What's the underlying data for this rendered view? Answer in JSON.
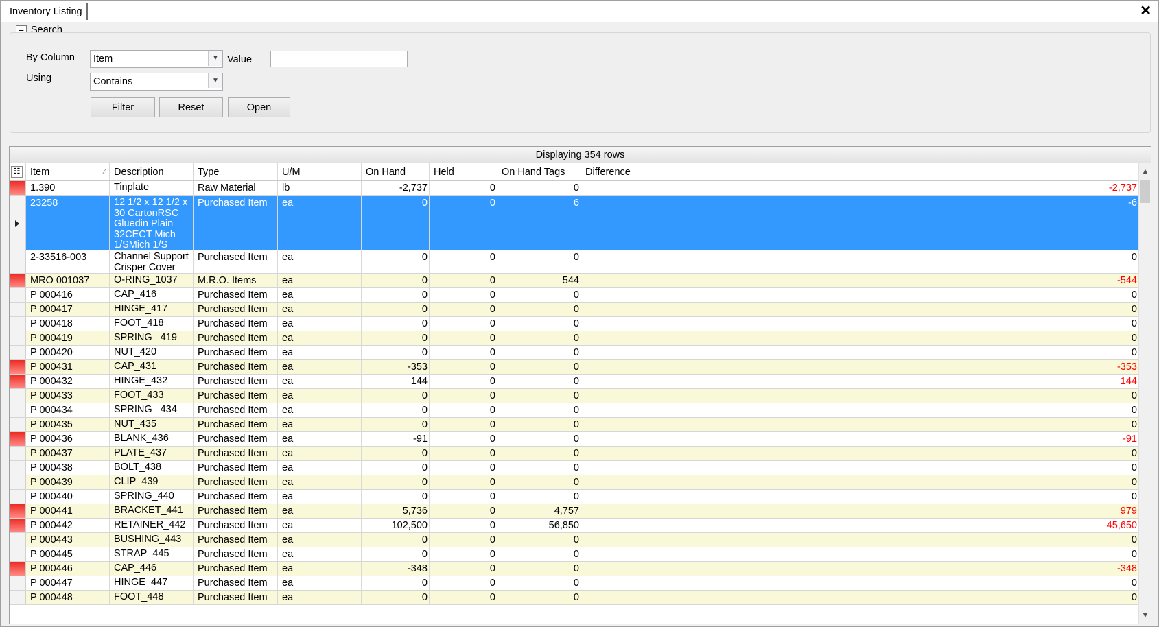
{
  "tab": {
    "title": "Inventory Listing",
    "close": "✕"
  },
  "search": {
    "collapse_glyph": "−",
    "title": "Search",
    "by_column_label": "By Column",
    "by_column_value": "Item",
    "value_label": "Value",
    "value_text": "",
    "using_label": "Using",
    "using_value": "Contains",
    "filter_label": "Filter",
    "reset_label": "Reset",
    "open_label": "Open"
  },
  "grid": {
    "banner": "Displaying 354 rows",
    "columns": [
      "Item",
      "Description",
      "Type",
      "U/M",
      "On Hand",
      "Held",
      "On Hand Tags",
      "Difference"
    ],
    "rows": [
      {
        "item": "1.390",
        "description": "Tinplate",
        "type": "Raw Material",
        "um": "lb",
        "on_hand": "-2,737",
        "held": "0",
        "tags": "0",
        "difference": "-2,737",
        "flag": true,
        "neg": true
      },
      {
        "item": "23258",
        "description": "12 1/2 x 12 1/2 x 30 CartonRSC Gluedin Plain 32CECT Mich 1/SMich 1/S",
        "type": "Purchased Item",
        "um": "ea",
        "on_hand": "0",
        "held": "0",
        "tags": "6",
        "difference": "-6",
        "flag": false,
        "neg": true,
        "selected": true
      },
      {
        "item": "2-33516-003",
        "description": "Channel Support Crisper Cover",
        "type": "Purchased Item",
        "um": "ea",
        "on_hand": "0",
        "held": "0",
        "tags": "0",
        "difference": "0",
        "flag": false,
        "neg": false
      },
      {
        "item": "MRO 001037",
        "description": "O-RING_1037",
        "type": "M.R.O. Items",
        "um": "ea",
        "on_hand": "0",
        "held": "0",
        "tags": "544",
        "difference": "-544",
        "flag": true,
        "neg": true
      },
      {
        "item": "P 000416",
        "description": "CAP_416",
        "type": "Purchased Item",
        "um": "ea",
        "on_hand": "0",
        "held": "0",
        "tags": "0",
        "difference": "0",
        "flag": false,
        "neg": false
      },
      {
        "item": "P 000417",
        "description": "HINGE_417",
        "type": "Purchased Item",
        "um": "ea",
        "on_hand": "0",
        "held": "0",
        "tags": "0",
        "difference": "0",
        "flag": false,
        "neg": false
      },
      {
        "item": "P 000418",
        "description": "FOOT_418",
        "type": "Purchased Item",
        "um": "ea",
        "on_hand": "0",
        "held": "0",
        "tags": "0",
        "difference": "0",
        "flag": false,
        "neg": false
      },
      {
        "item": "P 000419",
        "description": "SPRING _419",
        "type": "Purchased Item",
        "um": "ea",
        "on_hand": "0",
        "held": "0",
        "tags": "0",
        "difference": "0",
        "flag": false,
        "neg": false
      },
      {
        "item": "P 000420",
        "description": "NUT_420",
        "type": "Purchased Item",
        "um": "ea",
        "on_hand": "0",
        "held": "0",
        "tags": "0",
        "difference": "0",
        "flag": false,
        "neg": false
      },
      {
        "item": "P 000431",
        "description": "CAP_431",
        "type": "Purchased Item",
        "um": "ea",
        "on_hand": "-353",
        "held": "0",
        "tags": "0",
        "difference": "-353",
        "flag": true,
        "neg": true
      },
      {
        "item": "P 000432",
        "description": "HINGE_432",
        "type": "Purchased Item",
        "um": "ea",
        "on_hand": "144",
        "held": "0",
        "tags": "0",
        "difference": "144",
        "flag": true,
        "neg": true
      },
      {
        "item": "P 000433",
        "description": "FOOT_433",
        "type": "Purchased Item",
        "um": "ea",
        "on_hand": "0",
        "held": "0",
        "tags": "0",
        "difference": "0",
        "flag": false,
        "neg": false
      },
      {
        "item": "P 000434",
        "description": "SPRING _434",
        "type": "Purchased Item",
        "um": "ea",
        "on_hand": "0",
        "held": "0",
        "tags": "0",
        "difference": "0",
        "flag": false,
        "neg": false
      },
      {
        "item": "P 000435",
        "description": "NUT_435",
        "type": "Purchased Item",
        "um": "ea",
        "on_hand": "0",
        "held": "0",
        "tags": "0",
        "difference": "0",
        "flag": false,
        "neg": false
      },
      {
        "item": "P 000436",
        "description": "BLANK_436",
        "type": "Purchased Item",
        "um": "ea",
        "on_hand": "-91",
        "held": "0",
        "tags": "0",
        "difference": "-91",
        "flag": true,
        "neg": true
      },
      {
        "item": "P 000437",
        "description": "PLATE_437",
        "type": "Purchased Item",
        "um": "ea",
        "on_hand": "0",
        "held": "0",
        "tags": "0",
        "difference": "0",
        "flag": false,
        "neg": false
      },
      {
        "item": "P 000438",
        "description": "BOLT_438",
        "type": "Purchased Item",
        "um": "ea",
        "on_hand": "0",
        "held": "0",
        "tags": "0",
        "difference": "0",
        "flag": false,
        "neg": false
      },
      {
        "item": "P 000439",
        "description": "CLIP_439",
        "type": "Purchased Item",
        "um": "ea",
        "on_hand": "0",
        "held": "0",
        "tags": "0",
        "difference": "0",
        "flag": false,
        "neg": false
      },
      {
        "item": "P 000440",
        "description": "SPRING_440",
        "type": "Purchased Item",
        "um": "ea",
        "on_hand": "0",
        "held": "0",
        "tags": "0",
        "difference": "0",
        "flag": false,
        "neg": false
      },
      {
        "item": "P 000441",
        "description": "BRACKET_441",
        "type": "Purchased Item",
        "um": "ea",
        "on_hand": "5,736",
        "held": "0",
        "tags": "4,757",
        "difference": "979",
        "flag": true,
        "neg": true
      },
      {
        "item": "P 000442",
        "description": "RETAINER_442",
        "type": "Purchased Item",
        "um": "ea",
        "on_hand": "102,500",
        "held": "0",
        "tags": "56,850",
        "difference": "45,650",
        "flag": true,
        "neg": true
      },
      {
        "item": "P 000443",
        "description": "BUSHING_443",
        "type": "Purchased Item",
        "um": "ea",
        "on_hand": "0",
        "held": "0",
        "tags": "0",
        "difference": "0",
        "flag": false,
        "neg": false
      },
      {
        "item": "P 000445",
        "description": "STRAP_445",
        "type": "Purchased Item",
        "um": "ea",
        "on_hand": "0",
        "held": "0",
        "tags": "0",
        "difference": "0",
        "flag": false,
        "neg": false
      },
      {
        "item": "P 000446",
        "description": "CAP_446",
        "type": "Purchased Item",
        "um": "ea",
        "on_hand": "-348",
        "held": "0",
        "tags": "0",
        "difference": "-348",
        "flag": true,
        "neg": true
      },
      {
        "item": "P 000447",
        "description": "HINGE_447",
        "type": "Purchased Item",
        "um": "ea",
        "on_hand": "0",
        "held": "0",
        "tags": "0",
        "difference": "0",
        "flag": false,
        "neg": false
      },
      {
        "item": "P 000448",
        "description": "FOOT_448",
        "type": "Purchased Item",
        "um": "ea",
        "on_hand": "0",
        "held": "0",
        "tags": "0",
        "difference": "0",
        "flag": false,
        "neg": false
      }
    ]
  },
  "icons": {
    "column_chooser": "column-chooser-icon",
    "sort": "sort-indicator-icon"
  },
  "colors": {
    "selection": "#3399ff",
    "alt_row": "#f9f8d8",
    "flag": "#ee2a24",
    "negative_text": "#ff0000"
  }
}
